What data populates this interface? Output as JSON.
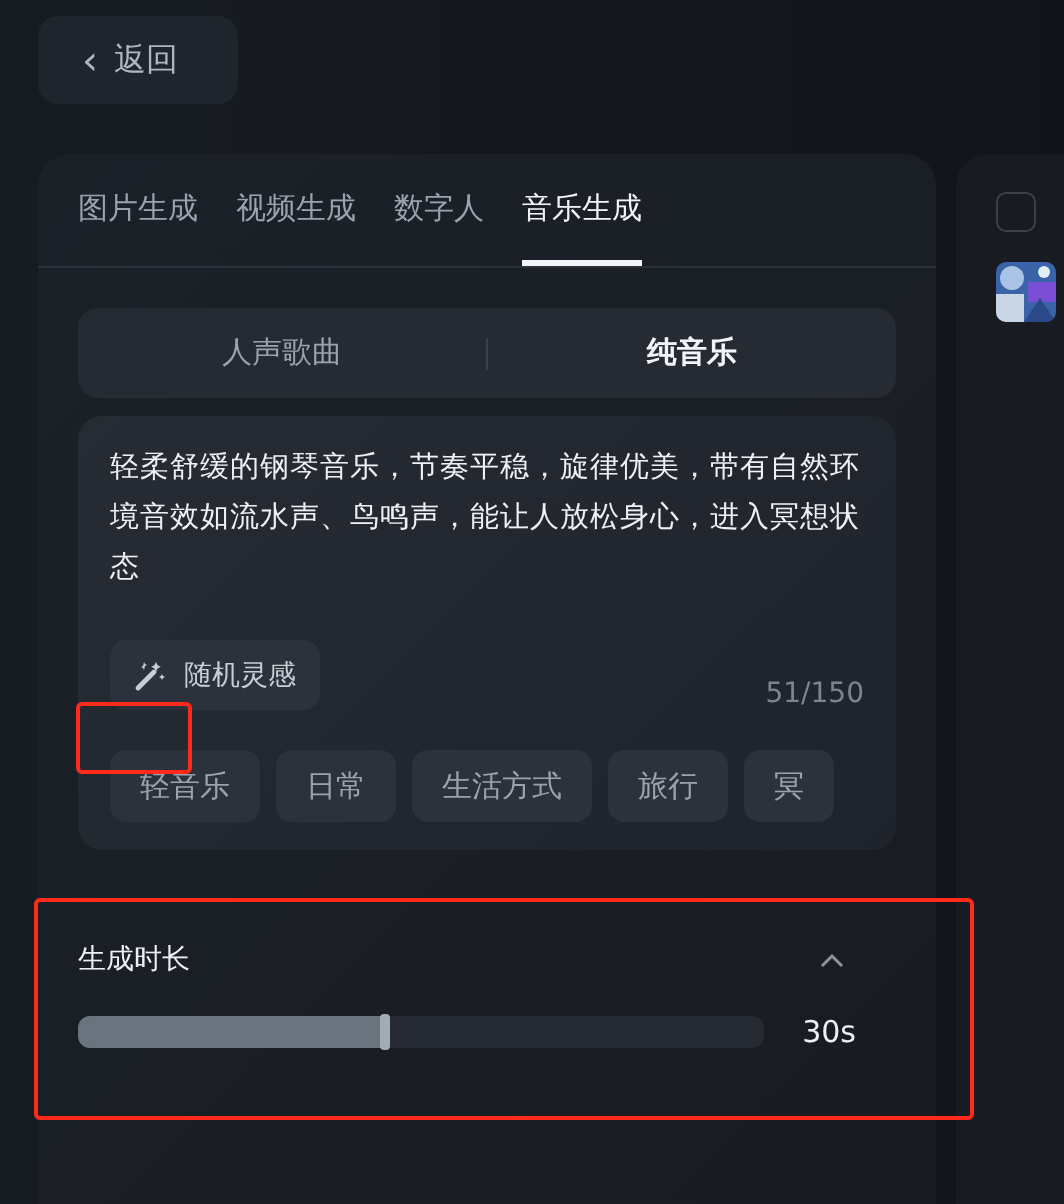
{
  "back_button": {
    "label": "返回",
    "icon": "‹"
  },
  "tabs": [
    {
      "label": "图片生成",
      "selected": false
    },
    {
      "label": "视频生成",
      "selected": false
    },
    {
      "label": "数字人",
      "selected": false
    },
    {
      "label": "音乐生成",
      "selected": true
    }
  ],
  "mode_switch": [
    {
      "label": "人声歌曲",
      "selected": false
    },
    {
      "label": "纯音乐",
      "selected": true
    }
  ],
  "prompt": {
    "value": "轻柔舒缓的钢琴音乐，节奏平稳，旋律优美，带有自然环境音效如流水声、鸟鸣声，能让人放松身心，进入冥想状态",
    "counter": "51/150"
  },
  "random_button": {
    "label": "随机灵感"
  },
  "tags": [
    {
      "label": "轻音乐",
      "highlighted": true
    },
    {
      "label": "日常",
      "highlighted": false
    },
    {
      "label": "生活方式",
      "highlighted": false
    },
    {
      "label": "旅行",
      "highlighted": false
    },
    {
      "label": "冥",
      "highlighted": false
    }
  ],
  "duration": {
    "title": "生成时长",
    "expanded": true,
    "level": 0.45,
    "reading": "30s",
    "highlighted": true
  },
  "side_panel": {
    "checked": false
  }
}
